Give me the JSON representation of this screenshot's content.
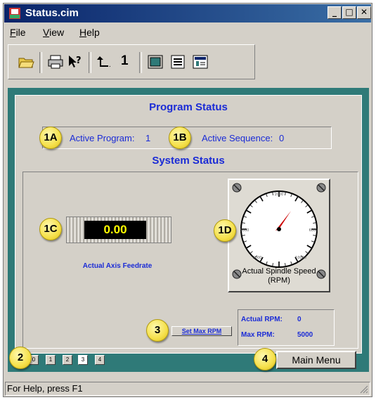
{
  "window": {
    "title": "Status.cim"
  },
  "menu": {
    "file_prefix": "F",
    "file_rest": "ile",
    "view_prefix": "V",
    "view_rest": "iew",
    "help_prefix": "H",
    "help_rest": "elp"
  },
  "toolbar": {
    "icons": [
      "open-folder-icon",
      "print-icon",
      "context-help-icon",
      "up-level-icon",
      "screen-view-icon",
      "list-view-icon",
      "detail-view-icon"
    ],
    "level_label": "1"
  },
  "program_status": {
    "title": "Program Status",
    "active_program_label": "Active Program:",
    "active_program_value": "1",
    "active_sequence_label": "Active Sequence:",
    "active_sequence_value": "0"
  },
  "system_status": {
    "title": "System Status",
    "feedrate_value": "0.00",
    "feedrate_label": "Actual Axis Feedrate",
    "gauge_label_line1": "Actual Spindle Speed",
    "gauge_label_line2": "(RPM)",
    "gauge_ticks": [
      "2000",
      "5000",
      "6000",
      "8000",
      "10000"
    ],
    "spindle_speed_rpm": 0,
    "actual_rpm_label": "Actual RPM:",
    "actual_rpm_value": "0",
    "max_rpm_label": "Max RPM:",
    "max_rpm_value": "5000",
    "set_max_button": "Set Max RPM"
  },
  "callouts": {
    "c1a": "1A",
    "c1b": "1B",
    "c1c": "1C",
    "c1d": "1D",
    "c2": "2",
    "c3": "3",
    "c4": "4"
  },
  "page_buttons": [
    "0",
    "1",
    "2",
    "3",
    "4"
  ],
  "active_page": "3",
  "main_menu_button": "Main Menu",
  "statusbar": {
    "text": "For Help, press F1"
  },
  "colors": {
    "titlebar": "#0a246a",
    "teal_panel": "#2f7a78",
    "label_blue": "#1a2bd6",
    "display_yellow": "#ffff00"
  }
}
